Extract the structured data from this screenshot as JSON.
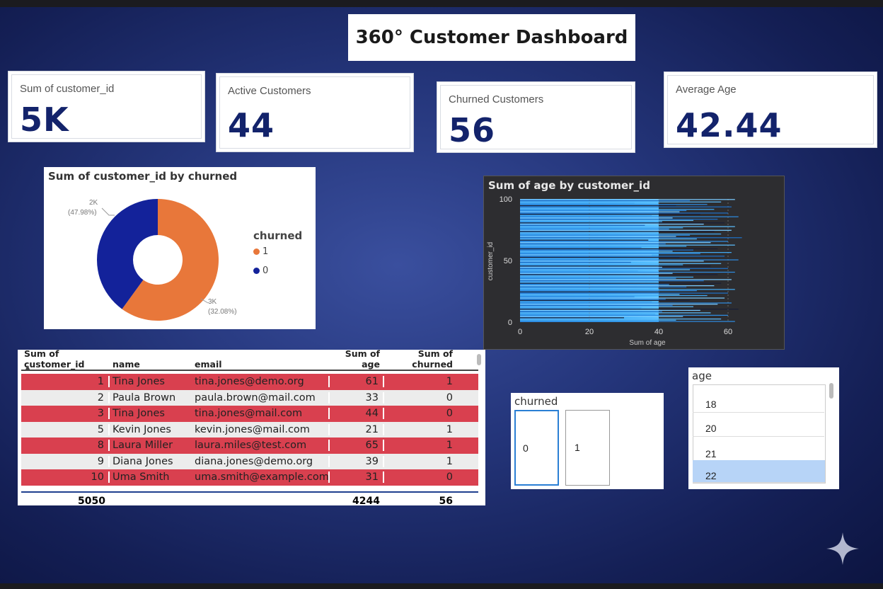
{
  "title": "360° Customer Dashboard",
  "kpis": [
    {
      "label": "Sum of customer_id",
      "value": "5K"
    },
    {
      "label": "Active Customers",
      "value": "44"
    },
    {
      "label": "Churned Customers",
      "value": "56"
    },
    {
      "label": "Average Age",
      "value": "42.44"
    }
  ],
  "donut": {
    "title": "Sum of customer_id by churned",
    "legend_title": "churned",
    "slices": [
      {
        "label": "1",
        "value": 3,
        "display": "3K",
        "pct": "(32.08%)",
        "color": "#e8773a"
      },
      {
        "label": "0",
        "value": 2,
        "display": "2K",
        "pct": "(47.98%)",
        "color": "#13229a"
      }
    ]
  },
  "chart_data": {
    "type": "bar",
    "title": "Sum of age by customer_id",
    "xlabel": "Sum of age",
    "ylabel": "customer_id",
    "xlim": [
      0,
      70
    ],
    "ylim": [
      0,
      100
    ],
    "x_ticks": [
      "0",
      "20",
      "40",
      "60"
    ],
    "y_ticks": [
      "0",
      "50",
      "100"
    ],
    "values": [
      62,
      45,
      58,
      30,
      47,
      60,
      39,
      55,
      41,
      52,
      63,
      35,
      50,
      44,
      57,
      61,
      38,
      49,
      42,
      59,
      33,
      54,
      46,
      60,
      40,
      51,
      62,
      37,
      48,
      56,
      43,
      58,
      36,
      53,
      61,
      45,
      50,
      39,
      57,
      44,
      62,
      34,
      49,
      60,
      41,
      55,
      47,
      58,
      32,
      53,
      63,
      40,
      46,
      59,
      38,
      52,
      61,
      44,
      50,
      57,
      35,
      48,
      62,
      42,
      55,
      60,
      37,
      51,
      64,
      45,
      49,
      58,
      39,
      56,
      61,
      43,
      47,
      62,
      36,
      53,
      59,
      41,
      50,
      57,
      44,
      63,
      38,
      52,
      60,
      46,
      48,
      56,
      40,
      61,
      45,
      54,
      33,
      58,
      49,
      62
    ]
  },
  "table": {
    "headers": [
      "Sum of customer_id",
      "name",
      "email",
      "Sum of age",
      "Sum of churned"
    ],
    "rows": [
      {
        "id": "1",
        "name": "Tina Jones",
        "email": "tina.jones@demo.org",
        "age": "61",
        "churned": "1"
      },
      {
        "id": "2",
        "name": "Paula Brown",
        "email": "paula.brown@mail.com",
        "age": "33",
        "churned": "0"
      },
      {
        "id": "3",
        "name": "Tina Jones",
        "email": "tina.jones@mail.com",
        "age": "44",
        "churned": "0"
      },
      {
        "id": "5",
        "name": "Kevin Jones",
        "email": "kevin.jones@mail.com",
        "age": "21",
        "churned": "1"
      },
      {
        "id": "8",
        "name": "Laura Miller",
        "email": "laura.miles@test.com",
        "age": "65",
        "churned": "1"
      },
      {
        "id": "9",
        "name": "Diana Jones",
        "email": "diana.jones@demo.org",
        "age": "39",
        "churned": "1"
      },
      {
        "id": "10",
        "name": "Uma Smith",
        "email": "uma.smith@example.com",
        "age": "31",
        "churned": "0"
      }
    ],
    "totals": {
      "id": "5050",
      "age": "4244",
      "churned": "56"
    }
  },
  "churned_slicer": {
    "title": "churned",
    "options": [
      "0",
      "1"
    ]
  },
  "age_slicer": {
    "title": "age",
    "options": [
      "18",
      "20",
      "21",
      "22"
    ],
    "selected": "22"
  },
  "colors": {
    "accent": "#13236b",
    "red_row": "#d9404f",
    "orange": "#e8773a",
    "navy": "#13229a"
  }
}
